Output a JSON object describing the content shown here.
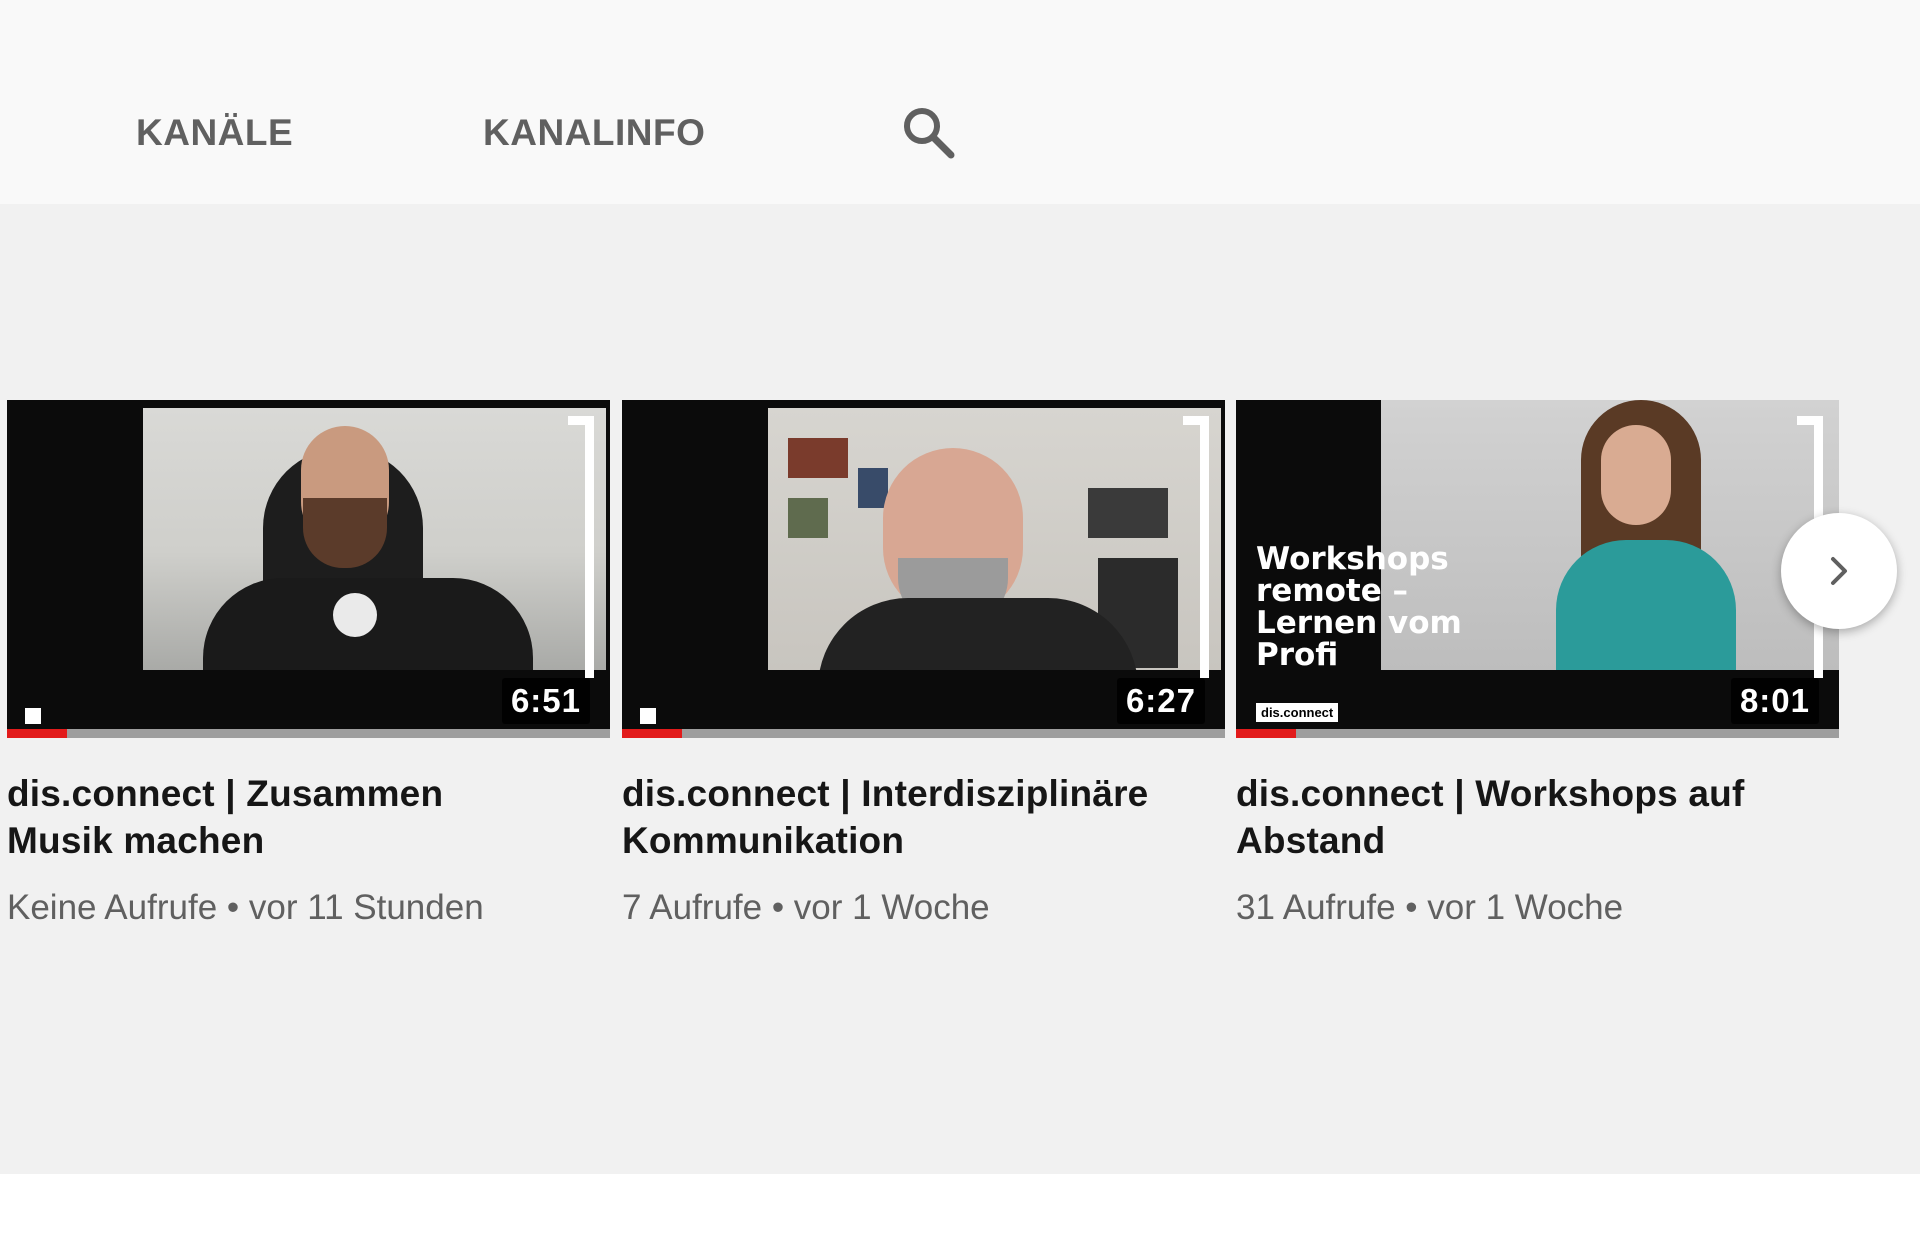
{
  "tabs": [
    {
      "label": "KANÄLE"
    },
    {
      "label": "KANALINFO"
    }
  ],
  "search": {
    "icon": "search-icon"
  },
  "videos": [
    {
      "duration": "6:51",
      "title_line1": "dis.connect | Zusammen",
      "title_line2": "Musik machen",
      "meta": "Keine Aufrufe • vor 11 Stunden",
      "progress": 0.1
    },
    {
      "duration": "6:27",
      "title_line1": "dis.connect | Interdisziplinäre",
      "title_line2": "Kommunikation",
      "meta": "7 Aufrufe • vor 1 Woche",
      "progress": 0.1
    },
    {
      "duration": "8:01",
      "title_line1": "dis.connect | Workshops auf",
      "title_line2": "Abstand",
      "meta": "31 Aufrufe • vor 1 Woche",
      "progress": 0.1,
      "overlay_lines": [
        "Workshops",
        "remote –",
        "Lernen vom",
        "Profi"
      ],
      "brand_tag": "dis.connect"
    }
  ],
  "colors": {
    "progress": "#e21b1b",
    "tab_text": "#606060",
    "content_bg": "#f1f1f1"
  },
  "next_button": {
    "icon": "chevron-right-icon"
  }
}
